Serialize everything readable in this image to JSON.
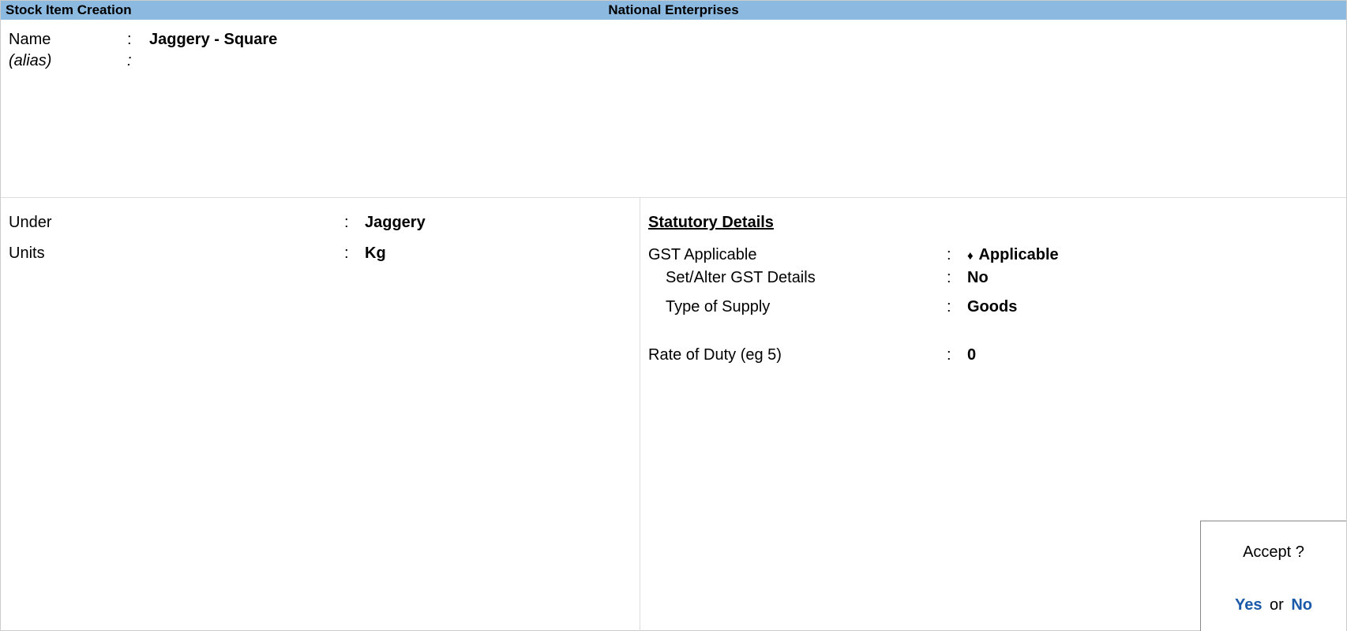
{
  "header": {
    "title": "Stock Item Creation",
    "company": "National Enterprises"
  },
  "top": {
    "name_label": "Name",
    "name_value": "Jaggery - Square",
    "alias_label": "(alias)",
    "alias_value": ""
  },
  "left": {
    "under_label": "Under",
    "under_value": "Jaggery",
    "units_label": "Units",
    "units_value": "Kg"
  },
  "right": {
    "heading": "Statutory Details",
    "gst_applicable_label": "GST Applicable",
    "gst_applicable_value": "Applicable",
    "set_alter_label": "Set/Alter GST Details",
    "set_alter_value": "No",
    "type_supply_label": "Type of Supply",
    "type_supply_value": "Goods",
    "rate_duty_label": "Rate of Duty (eg 5)",
    "rate_duty_value": "0"
  },
  "accept": {
    "question": "Accept ?",
    "yes": "Yes",
    "or": "or",
    "no": "No"
  }
}
